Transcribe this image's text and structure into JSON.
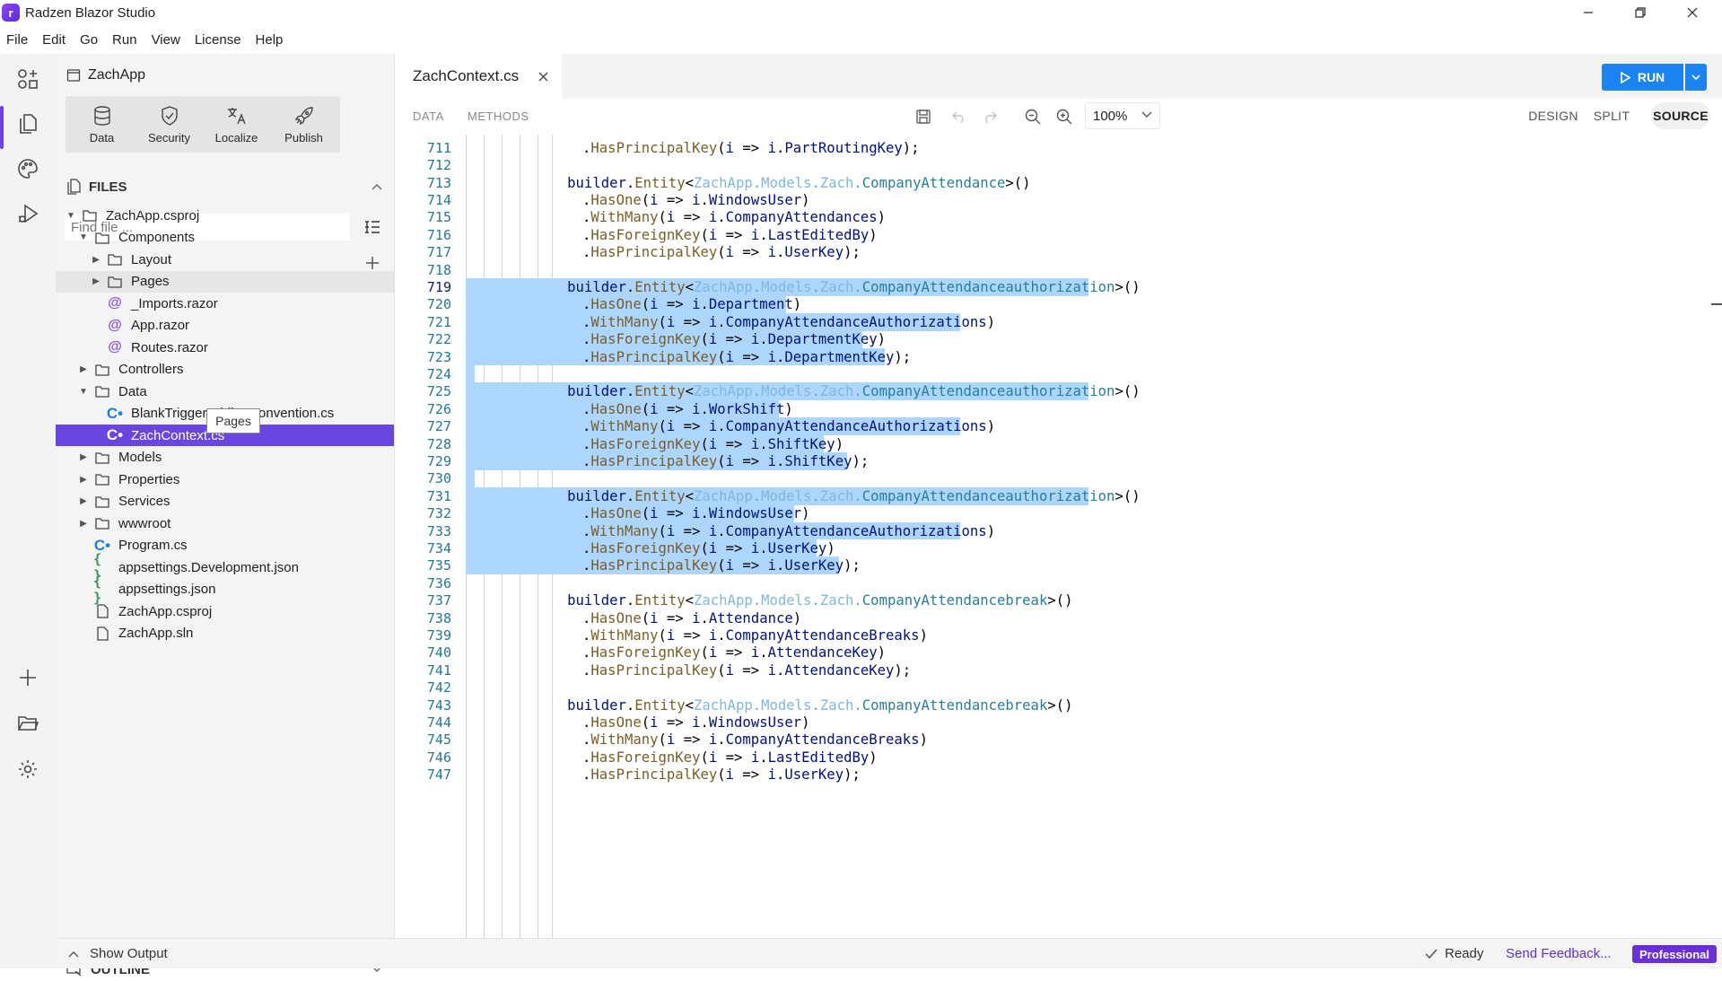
{
  "window": {
    "title": "Radzen Blazor Studio",
    "logo_letter": "r"
  },
  "menu": [
    "File",
    "Edit",
    "Go",
    "Run",
    "View",
    "License",
    "Help"
  ],
  "sidebar": {
    "project_name": "ZachApp",
    "tools": [
      {
        "label": "Data",
        "icon": "database-icon"
      },
      {
        "label": "Security",
        "icon": "shield-icon"
      },
      {
        "label": "Localize",
        "icon": "translate-icon"
      },
      {
        "label": "Publish",
        "icon": "rocket-icon"
      }
    ],
    "files_header": "FILES",
    "find_placeholder": "Find file ...",
    "tree": [
      {
        "label": "ZachApp.csproj",
        "icon": "folder",
        "depth": 0,
        "caret": "down"
      },
      {
        "label": "Components",
        "icon": "folder",
        "depth": 1,
        "caret": "down"
      },
      {
        "label": "Layout",
        "icon": "folder",
        "depth": 2,
        "caret": "right"
      },
      {
        "label": "Pages",
        "icon": "folder",
        "depth": 2,
        "caret": "right",
        "hover": true
      },
      {
        "label": "_Imports.razor",
        "icon": "razor",
        "depth": 2,
        "caret": ""
      },
      {
        "label": "App.razor",
        "icon": "razor",
        "depth": 2,
        "caret": ""
      },
      {
        "label": "Routes.razor",
        "icon": "razor",
        "depth": 2,
        "caret": ""
      },
      {
        "label": "Controllers",
        "icon": "folder",
        "depth": 1,
        "caret": "right"
      },
      {
        "label": "Data",
        "icon": "folder",
        "depth": 1,
        "caret": "down"
      },
      {
        "label": "BlankTriggerAddingConvention.cs",
        "icon": "csharp",
        "depth": 2,
        "caret": ""
      },
      {
        "label": "ZachContext.cs",
        "icon": "csharp",
        "depth": 2,
        "caret": "",
        "selected": true
      },
      {
        "label": "Models",
        "icon": "folder",
        "depth": 1,
        "caret": "right"
      },
      {
        "label": "Properties",
        "icon": "folder",
        "depth": 1,
        "caret": "right"
      },
      {
        "label": "Services",
        "icon": "folder",
        "depth": 1,
        "caret": "right"
      },
      {
        "label": "wwwroot",
        "icon": "folder",
        "depth": 1,
        "caret": "right"
      },
      {
        "label": "Program.cs",
        "icon": "csharp",
        "depth": 1,
        "caret": ""
      },
      {
        "label": "appsettings.Development.json",
        "icon": "json",
        "depth": 1,
        "caret": ""
      },
      {
        "label": "appsettings.json",
        "icon": "json",
        "depth": 1,
        "caret": ""
      },
      {
        "label": "ZachApp.csproj",
        "icon": "file",
        "depth": 1,
        "caret": ""
      },
      {
        "label": "ZachApp.sln",
        "icon": "file",
        "depth": 1,
        "caret": ""
      }
    ],
    "tooltip": "Pages",
    "outline_header": "OUTLINE"
  },
  "editor": {
    "tab_label": "ZachContext.cs",
    "run_label": "RUN",
    "left_tabs": [
      "DATA",
      "METHODS"
    ],
    "zoom": "100%",
    "view_modes": [
      "DESIGN",
      "SPLIT",
      "SOURCE"
    ],
    "active_view": "SOURCE",
    "current_line": 719,
    "selection": {
      "from": 719,
      "to": 735
    },
    "lines": [
      {
        "n": 711,
        "kind": "call",
        "method": "HasPrincipalKey",
        "arg": "PartRoutingKey",
        "end": ");"
      },
      {
        "n": 712,
        "kind": "blank"
      },
      {
        "n": 713,
        "kind": "entity",
        "entity": "CompanyAttendance"
      },
      {
        "n": 714,
        "kind": "call",
        "method": "HasOne",
        "arg": "WindowsUser",
        "end": ")"
      },
      {
        "n": 715,
        "kind": "call",
        "method": "WithMany",
        "arg": "CompanyAttendances",
        "end": ")"
      },
      {
        "n": 716,
        "kind": "call",
        "method": "HasForeignKey",
        "arg": "LastEditedBy",
        "end": ")"
      },
      {
        "n": 717,
        "kind": "call",
        "method": "HasPrincipalKey",
        "arg": "UserKey",
        "end": ");"
      },
      {
        "n": 718,
        "kind": "blank"
      },
      {
        "n": 719,
        "kind": "entity",
        "entity": "CompanyAttendanceauthorization"
      },
      {
        "n": 720,
        "kind": "call",
        "method": "HasOne",
        "arg": "Department",
        "end": ")"
      },
      {
        "n": 721,
        "kind": "call",
        "method": "WithMany",
        "arg": "CompanyAttendanceAuthorizations",
        "end": ")"
      },
      {
        "n": 722,
        "kind": "call",
        "method": "HasForeignKey",
        "arg": "DepartmentKey",
        "end": ")"
      },
      {
        "n": 723,
        "kind": "call",
        "method": "HasPrincipalKey",
        "arg": "DepartmentKey",
        "end": ");"
      },
      {
        "n": 724,
        "kind": "blank"
      },
      {
        "n": 725,
        "kind": "entity",
        "entity": "CompanyAttendanceauthorization"
      },
      {
        "n": 726,
        "kind": "call",
        "method": "HasOne",
        "arg": "WorkShift",
        "end": ")"
      },
      {
        "n": 727,
        "kind": "call",
        "method": "WithMany",
        "arg": "CompanyAttendanceAuthorizations",
        "end": ")"
      },
      {
        "n": 728,
        "kind": "call",
        "method": "HasForeignKey",
        "arg": "ShiftKey",
        "end": ")"
      },
      {
        "n": 729,
        "kind": "call",
        "method": "HasPrincipalKey",
        "arg": "ShiftKey",
        "end": ");"
      },
      {
        "n": 730,
        "kind": "blank"
      },
      {
        "n": 731,
        "kind": "entity",
        "entity": "CompanyAttendanceauthorization"
      },
      {
        "n": 732,
        "kind": "call",
        "method": "HasOne",
        "arg": "WindowsUser",
        "end": ")"
      },
      {
        "n": 733,
        "kind": "call",
        "method": "WithMany",
        "arg": "CompanyAttendanceAuthorizations",
        "end": ")"
      },
      {
        "n": 734,
        "kind": "call",
        "method": "HasForeignKey",
        "arg": "UserKey",
        "end": ")"
      },
      {
        "n": 735,
        "kind": "call",
        "method": "HasPrincipalKey",
        "arg": "UserKey",
        "end": ");"
      },
      {
        "n": 736,
        "kind": "blank"
      },
      {
        "n": 737,
        "kind": "entity",
        "entity": "CompanyAttendancebreak"
      },
      {
        "n": 738,
        "kind": "call",
        "method": "HasOne",
        "arg": "Attendance",
        "end": ")"
      },
      {
        "n": 739,
        "kind": "call",
        "method": "WithMany",
        "arg": "CompanyAttendanceBreaks",
        "end": ")"
      },
      {
        "n": 740,
        "kind": "call",
        "method": "HasForeignKey",
        "arg": "AttendanceKey",
        "end": ")"
      },
      {
        "n": 741,
        "kind": "call",
        "method": "HasPrincipalKey",
        "arg": "AttendanceKey",
        "end": ");"
      },
      {
        "n": 742,
        "kind": "blank"
      },
      {
        "n": 743,
        "kind": "entity",
        "entity": "CompanyAttendancebreak"
      },
      {
        "n": 744,
        "kind": "call",
        "method": "HasOne",
        "arg": "WindowsUser",
        "end": ")"
      },
      {
        "n": 745,
        "kind": "call",
        "method": "WithMany",
        "arg": "CompanyAttendanceBreaks",
        "end": ")"
      },
      {
        "n": 746,
        "kind": "call",
        "method": "HasForeignKey",
        "arg": "LastEditedBy",
        "end": ")"
      },
      {
        "n": 747,
        "kind": "call",
        "method": "HasPrincipalKey",
        "arg": "UserKey",
        "end": ");"
      }
    ]
  },
  "status": {
    "show_output": "Show Output",
    "ready": "Ready",
    "feedback": "Send Feedback...",
    "edition": "Professional"
  },
  "colors": {
    "accent": "#6a46e0",
    "run": "#1c84f0",
    "selection": "#add6ff"
  }
}
